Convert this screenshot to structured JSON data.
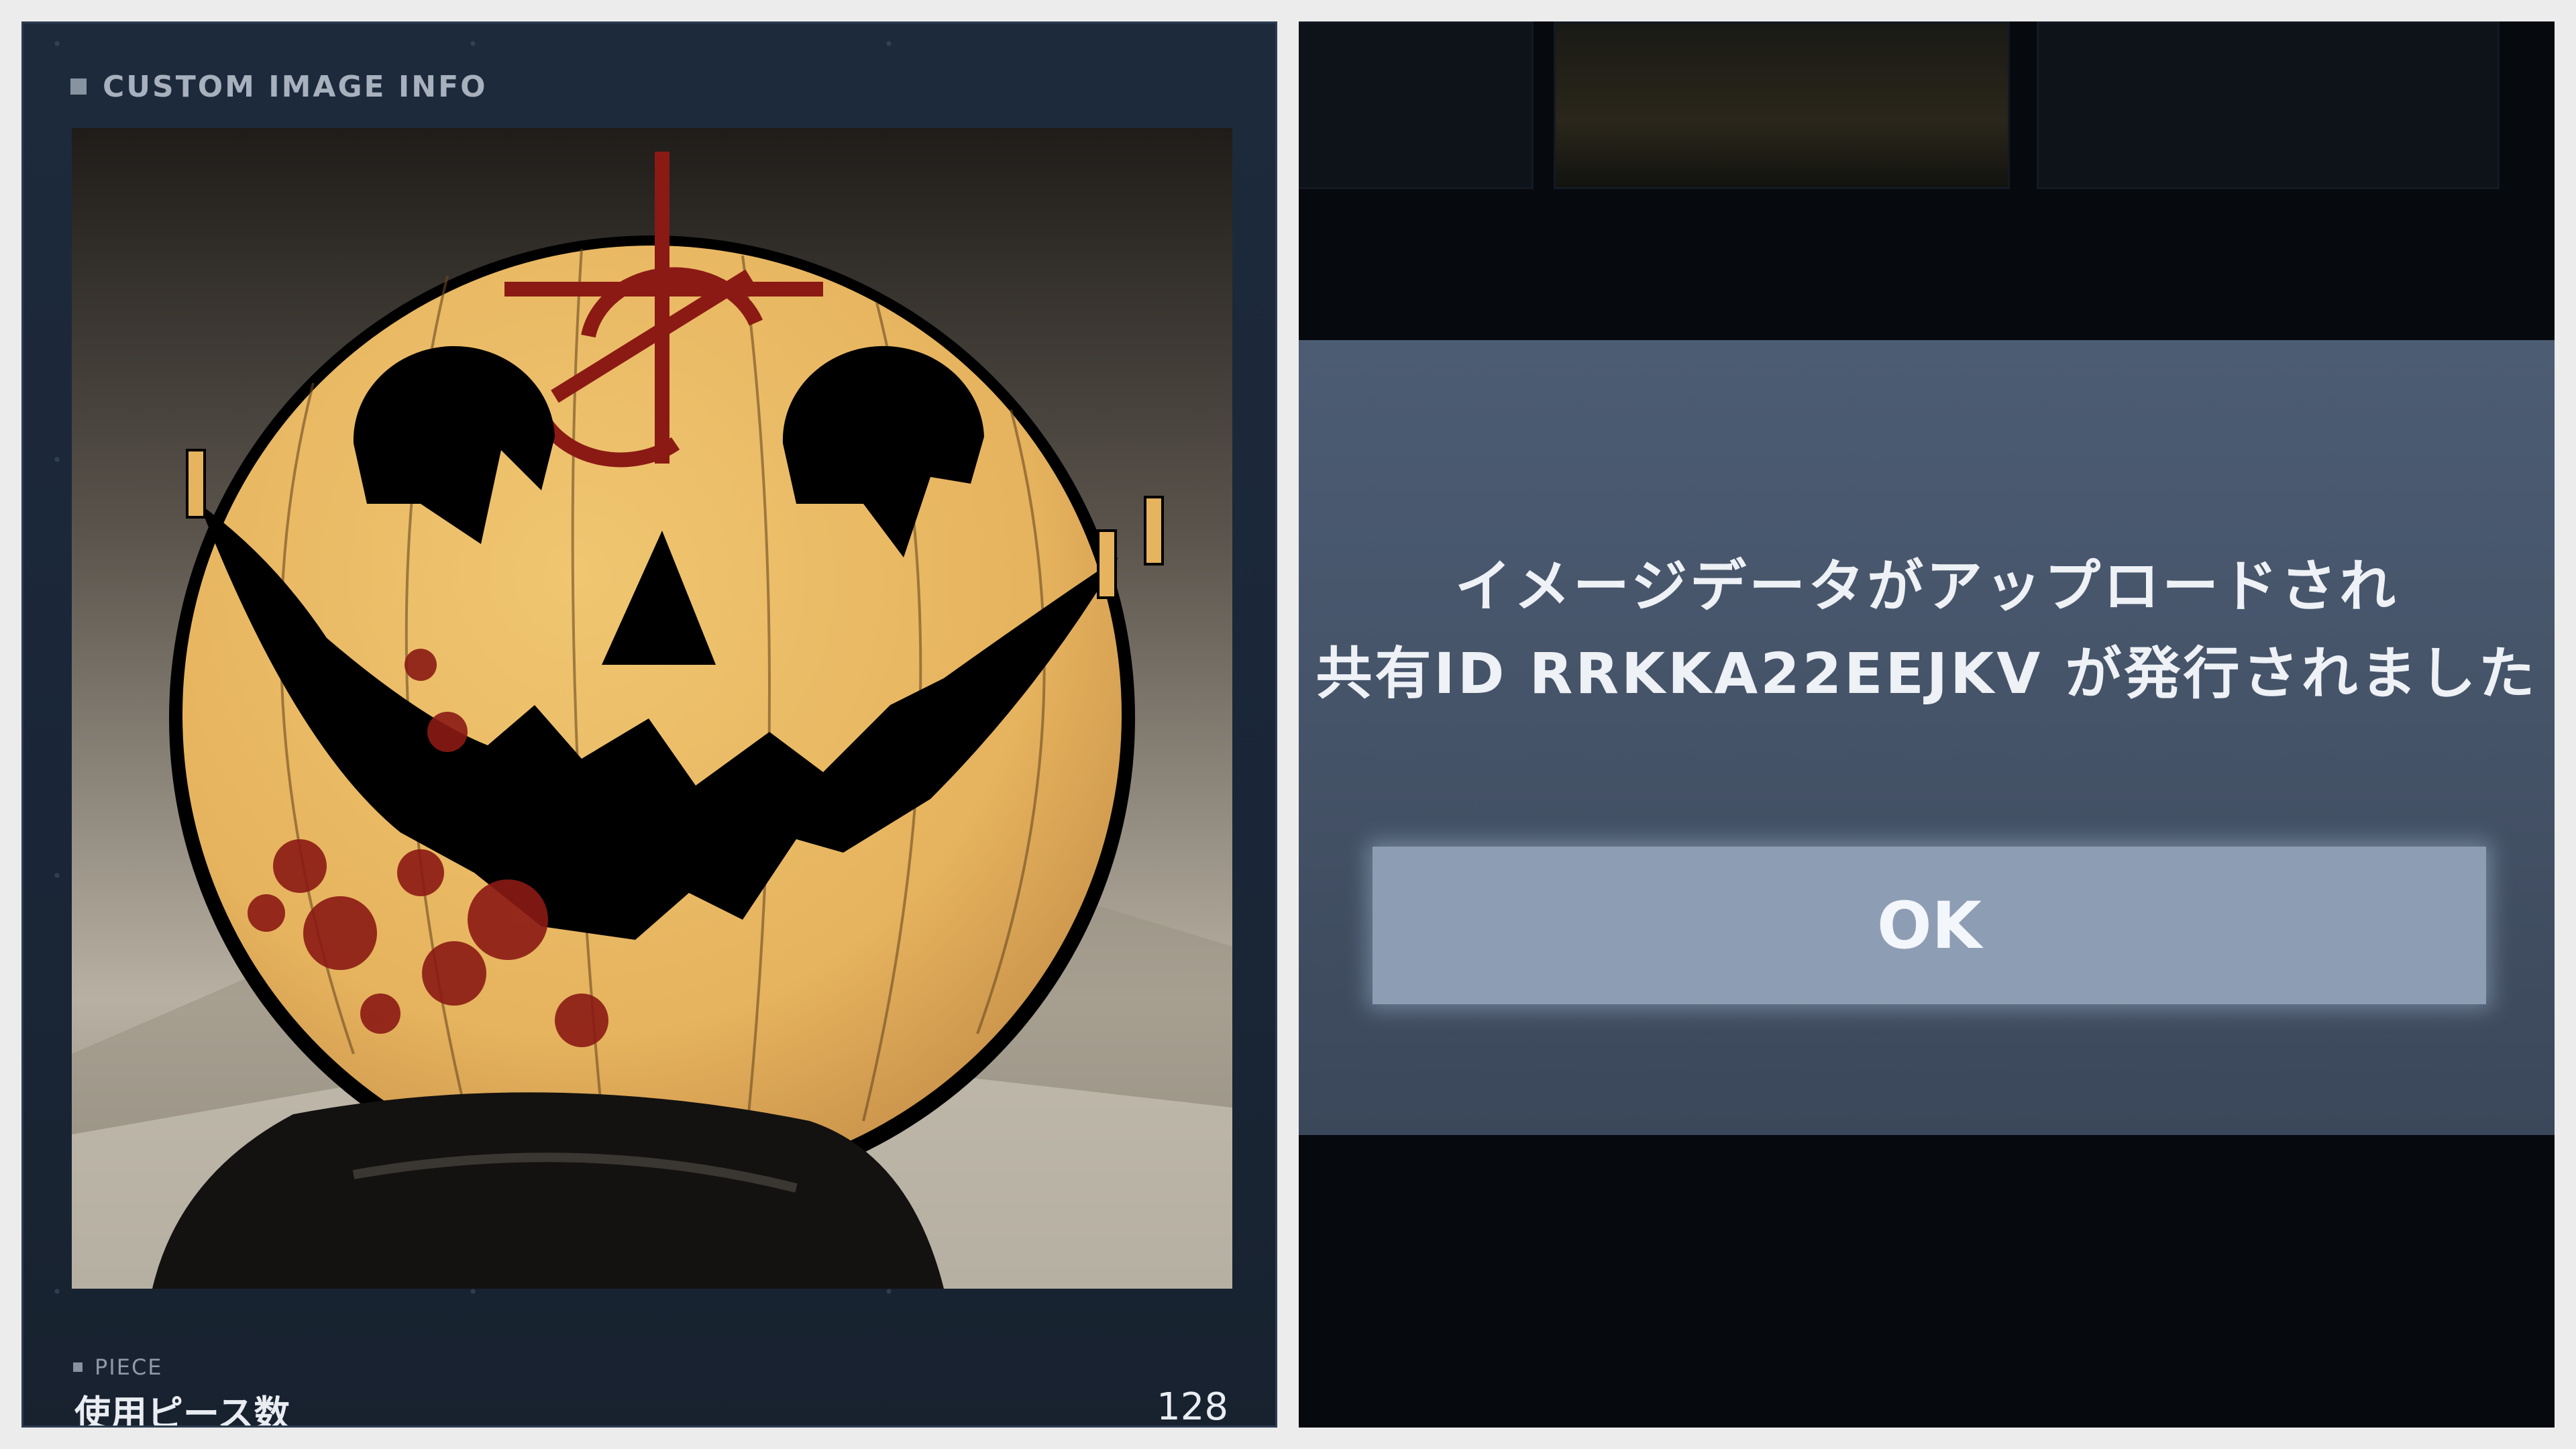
{
  "left_panel": {
    "header_title": "CUSTOM IMAGE INFO",
    "piece_label": "PIECE",
    "piece_name": "使用ピース数",
    "piece_count": "128"
  },
  "dialog": {
    "message_line1": "イメージデータがアップロードされ",
    "message_line2": "共有ID RRKKA22EEJKV が発行されました",
    "ok_label": "OK"
  },
  "colors": {
    "panel_bg": "#1d2a3c",
    "dialog_bg": "#4c5c73",
    "button_bg": "#8d9db4",
    "pumpkin": "#e8b862",
    "blood": "#8b1a14"
  }
}
